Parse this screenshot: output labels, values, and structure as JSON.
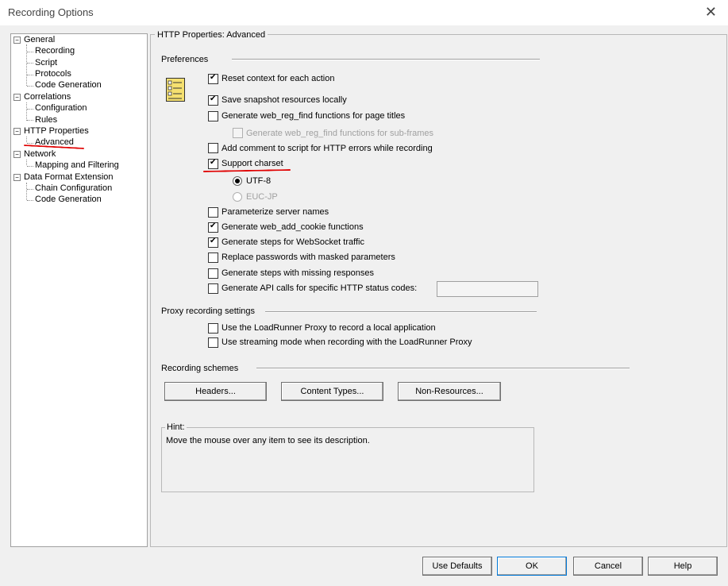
{
  "window": {
    "title": "Recording Options"
  },
  "tree": [
    {
      "label": "General",
      "expander": "⊟"
    },
    {
      "label": "Recording"
    },
    {
      "label": "Script"
    },
    {
      "label": "Protocols"
    },
    {
      "label": "Code Generation"
    },
    {
      "label": "Correlations",
      "expander": "⊟"
    },
    {
      "label": "Configuration"
    },
    {
      "label": "Rules"
    },
    {
      "label": "HTTP Properties",
      "expander": "⊟"
    },
    {
      "label": "Advanced",
      "selected": true
    },
    {
      "label": "Network",
      "expander": "⊟"
    },
    {
      "label": "Mapping and Filtering"
    },
    {
      "label": "Data Format Extension",
      "expander": "⊟"
    },
    {
      "label": "Chain Configuration"
    },
    {
      "label": "Code Generation"
    }
  ],
  "panel": {
    "title": "HTTP Properties: Advanced",
    "preferences": {
      "header": "Preferences",
      "options": [
        {
          "label": "Reset context for each action",
          "checked": true
        },
        {
          "label": "Save snapshot resources locally",
          "checked": true
        },
        {
          "label": "Generate web_reg_find functions for page titles",
          "checked": false
        },
        {
          "label": "Generate web_reg_find functions for sub-frames",
          "checked": false,
          "disabled": true
        },
        {
          "label": "Add comment to script for HTTP errors while recording",
          "checked": false
        },
        {
          "label": "Support charset",
          "checked": true
        },
        {
          "label": "Parameterize server names",
          "checked": false
        },
        {
          "label": "Generate web_add_cookie functions",
          "checked": true
        },
        {
          "label": "Generate steps for WebSocket traffic",
          "checked": true
        },
        {
          "label": "Replace passwords with masked parameters",
          "checked": false
        },
        {
          "label": "Generate steps with missing responses",
          "checked": false
        },
        {
          "label": "Generate API calls for specific HTTP status codes:",
          "checked": false
        }
      ],
      "charset_options": [
        {
          "label": "UTF-8",
          "selected": true
        },
        {
          "label": "EUC-JP",
          "selected": false,
          "disabled": true
        }
      ],
      "status_codes_value": ""
    },
    "proxy": {
      "header": "Proxy recording settings",
      "options": [
        {
          "label": "Use the LoadRunner Proxy to record a local application",
          "checked": false
        },
        {
          "label": "Use streaming mode when recording with the LoadRunner Proxy",
          "checked": false
        }
      ]
    },
    "schemes": {
      "header": "Recording schemes",
      "buttons": [
        "Headers...",
        "Content Types...",
        "Non-Resources..."
      ]
    },
    "hint": {
      "title": "Hint:",
      "text": "Move the mouse over any item to see its description."
    }
  },
  "footer": {
    "buttons": [
      "Use Defaults",
      "OK",
      "Cancel",
      "Help"
    ]
  },
  "icons": {
    "close": "close-icon",
    "doc": "checklist-document-icon"
  },
  "colors": {
    "annotation": "#e00000",
    "window_bg": "#f0f0f0"
  }
}
